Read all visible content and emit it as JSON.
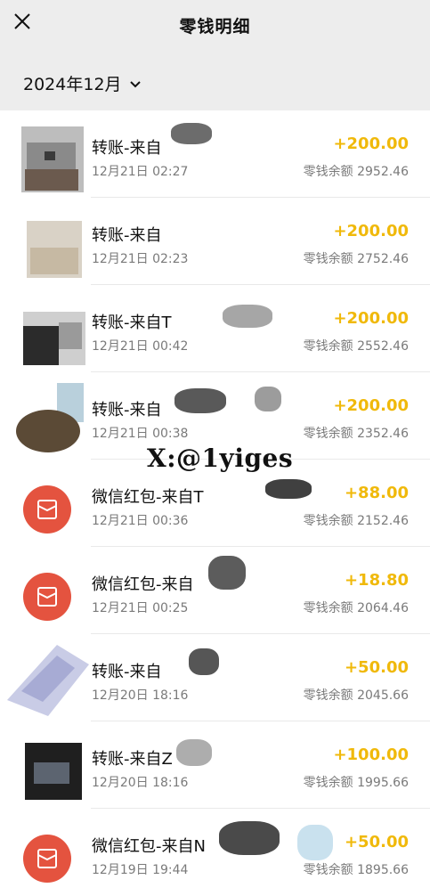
{
  "header": {
    "title": "零钱明细",
    "close_icon": "close-icon"
  },
  "filter": {
    "month": "2024年12月",
    "dropdown_icon": "chevron-down-icon"
  },
  "watermark": "X:@1yiges",
  "transactions": [
    {
      "type": "transfer",
      "title": "转账-来自",
      "time": "12月21日 02:27",
      "amount": "+200.00",
      "balance": "零钱余额 2952.46"
    },
    {
      "type": "transfer",
      "title": "转账-来自",
      "time": "12月21日 02:23",
      "amount": "+200.00",
      "balance": "零钱余额 2752.46"
    },
    {
      "type": "transfer",
      "title": "转账-来自T",
      "time": "12月21日 00:42",
      "amount": "+200.00",
      "balance": "零钱余额 2552.46"
    },
    {
      "type": "transfer",
      "title": "转账-来自",
      "time": "12月21日 00:38",
      "amount": "+200.00",
      "balance": "零钱余额 2352.46"
    },
    {
      "type": "redpacket",
      "title": "微信红包-来自T",
      "time": "12月21日 00:36",
      "amount": "+88.00",
      "balance": "零钱余额 2152.46"
    },
    {
      "type": "redpacket",
      "title": "微信红包-来自",
      "time": "12月21日 00:25",
      "amount": "+18.80",
      "balance": "零钱余额 2064.46"
    },
    {
      "type": "transfer",
      "title": "转账-来自",
      "time": "12月20日 18:16",
      "amount": "+50.00",
      "balance": "零钱余额 2045.66"
    },
    {
      "type": "transfer",
      "title": "转账-来自Z",
      "time": "12月20日 18:16",
      "amount": "+100.00",
      "balance": "零钱余额 1995.66"
    },
    {
      "type": "redpacket",
      "title": "微信红包-来自N",
      "time": "12月19日 19:44",
      "amount": "+50.00",
      "balance": "零钱余额 1895.66"
    }
  ],
  "colors": {
    "amount": "#f0b90b",
    "redpacket": "#e4533f",
    "background": "#ededed"
  }
}
